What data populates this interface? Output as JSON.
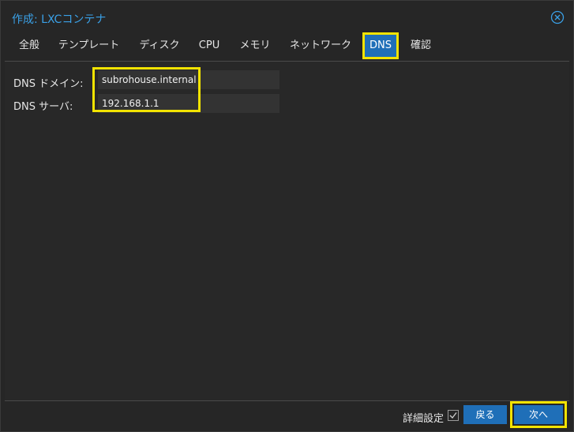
{
  "window": {
    "title": "作成: LXCコンテナ",
    "close_icon": "close-circle-icon"
  },
  "tabs": [
    {
      "label": "全般",
      "active": false
    },
    {
      "label": "テンプレート",
      "active": false
    },
    {
      "label": "ディスク",
      "active": false
    },
    {
      "label": "CPU",
      "active": false
    },
    {
      "label": "メモリ",
      "active": false
    },
    {
      "label": "ネットワーク",
      "active": false
    },
    {
      "label": "DNS",
      "active": true
    },
    {
      "label": "確認",
      "active": false
    }
  ],
  "form": {
    "dns_domain": {
      "label": "DNS ドメイン:",
      "value": "subrohouse.internal"
    },
    "dns_server": {
      "label": "DNS サーバ:",
      "value": "192.168.1.1"
    }
  },
  "footer": {
    "advanced_label": "詳細設定",
    "advanced_checked": true,
    "back_label": "戻る",
    "next_label": "次へ"
  },
  "colors": {
    "accent": "#1f6fb8",
    "title": "#3aa0e6",
    "highlight": "#f2e300",
    "background": "#262626"
  }
}
